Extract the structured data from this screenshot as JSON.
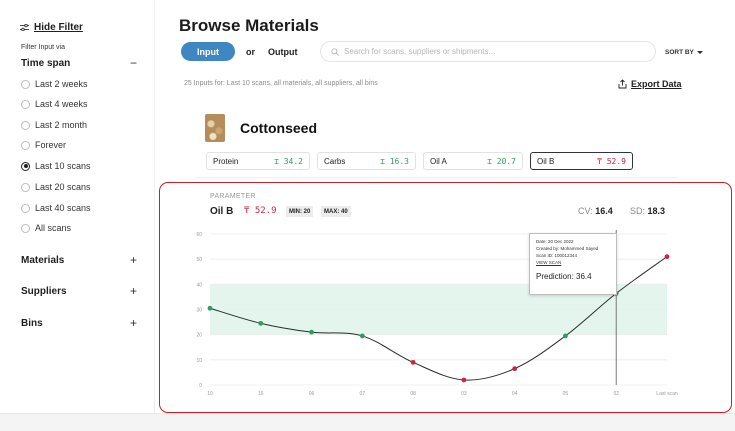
{
  "sidebar": {
    "hide_filter": "Hide Filter",
    "filter_input_via": "Filter Input via",
    "time_span": {
      "title": "Time span",
      "sign": "−"
    },
    "time_options": [
      {
        "label": "Last 2 weeks",
        "checked": false
      },
      {
        "label": "Last 4 weeks",
        "checked": false
      },
      {
        "label": "Last 2 month",
        "checked": false
      },
      {
        "label": "Forever",
        "checked": false
      },
      {
        "label": "Last 10 scans",
        "checked": true
      },
      {
        "label": "Last 20 scans",
        "checked": false
      },
      {
        "label": "Last 40 scans",
        "checked": false
      },
      {
        "label": "All scans",
        "checked": false
      }
    ],
    "collapsed_sections": [
      {
        "title": "Materials",
        "sign": "+"
      },
      {
        "title": "Suppliers",
        "sign": "+"
      },
      {
        "title": "Bins",
        "sign": "+"
      }
    ]
  },
  "header": {
    "title": "Browse Materials",
    "toggle": {
      "active": "Input",
      "or": "or",
      "inactive": "Output"
    },
    "search_placeholder": "Search for scans, suppliers or shipments...",
    "sort_by": "SORT BY"
  },
  "summary": "25 Inputs for: Last 10 scans, all materials, all suppliers, all bins",
  "export_label": "Export Data",
  "material": {
    "name": "Cottonseed",
    "parameters": [
      {
        "name": "Protein",
        "value": "34.2",
        "status": "ok",
        "selected": false
      },
      {
        "name": "Carbs",
        "value": "16.3",
        "status": "ok",
        "selected": false
      },
      {
        "name": "Oil A",
        "value": "20.7",
        "status": "ok",
        "selected": false
      },
      {
        "name": "Oil B",
        "value": "52.9",
        "status": "bad",
        "selected": true
      }
    ]
  },
  "parameter_panel": {
    "label": "PARAMETER",
    "name": "Oil B",
    "value": "52.9",
    "min_label": "MIN: 20",
    "max_label": "MAX: 40",
    "cv_label": "CV:",
    "cv_value": "16.4",
    "sd_label": "SD:",
    "sd_value": "18.3",
    "tooltip": {
      "date": "Date: 20 Dec 2022",
      "created_by": "Created by: Mohammed Sayed",
      "scan_id": "Scan ID: 100012344",
      "view_scan": "VIEW SCAN",
      "prediction_label": "Prediction:",
      "prediction_value": "36.4"
    }
  },
  "colors": {
    "accent": "#3e87c2",
    "ok": "#2e9e5e",
    "bad": "#d0243a",
    "band": "#e4f5ee",
    "panel_border": "#cc1d22"
  },
  "chart_data": {
    "type": "line",
    "x": [
      "10",
      "16",
      "06",
      "07",
      "08",
      "03",
      "04",
      "05",
      "02",
      "Last scan"
    ],
    "values": [
      30.5,
      24.5,
      21,
      19.5,
      9,
      2,
      6.5,
      19.5,
      36.4,
      51
    ],
    "status": [
      "ok",
      "ok",
      "ok",
      "ok",
      "bad",
      "bad",
      "bad",
      "ok",
      "ok",
      "bad"
    ],
    "yticks": [
      0,
      10,
      20,
      30,
      40,
      50,
      60
    ],
    "ylim": [
      0,
      60
    ],
    "band": [
      20,
      40
    ],
    "highlight_index": 8,
    "grid": true
  }
}
